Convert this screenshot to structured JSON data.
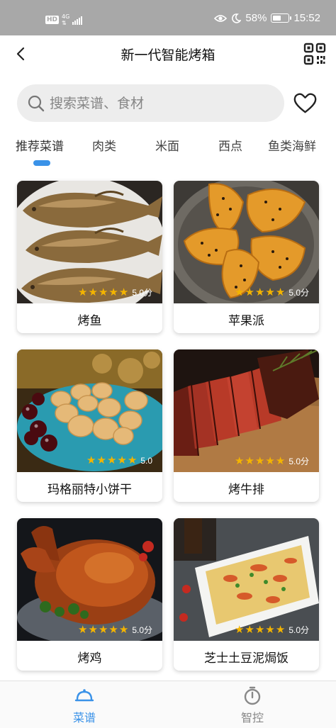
{
  "status_bar": {
    "hd": "HD",
    "net": "4G",
    "battery_pct": "58%",
    "battery_level": 0.58,
    "time": "15:52"
  },
  "header": {
    "title": "新一代智能烤箱"
  },
  "search": {
    "placeholder": "搜索菜谱、食材"
  },
  "tabs": [
    "推荐菜谱",
    "肉类",
    "米面",
    "西点",
    "鱼类海鲜"
  ],
  "active_tab": "推荐菜谱",
  "recipes": [
    {
      "name": "烤鱼",
      "stars": 5,
      "score": "5.0分"
    },
    {
      "name": "苹果派",
      "stars": 5,
      "score": "5.0分"
    },
    {
      "name": "玛格丽特小饼干",
      "stars": 5,
      "score": "5.0"
    },
    {
      "name": "烤牛排",
      "stars": 5,
      "score": "5.0分"
    },
    {
      "name": "烤鸡",
      "stars": 5,
      "score": "5.0分"
    },
    {
      "name": "芝士土豆泥焗饭",
      "stars": 5,
      "score": "5.0分"
    }
  ],
  "bottom_nav": [
    {
      "label": "菜谱",
      "icon": "cloche-icon",
      "active": true
    },
    {
      "label": "智控",
      "icon": "timer-icon",
      "active": false
    }
  ],
  "colors": {
    "accent": "#3a92e8",
    "star": "#f4b400",
    "status_bar": "#a8a8a8",
    "inactive": "#888888"
  }
}
